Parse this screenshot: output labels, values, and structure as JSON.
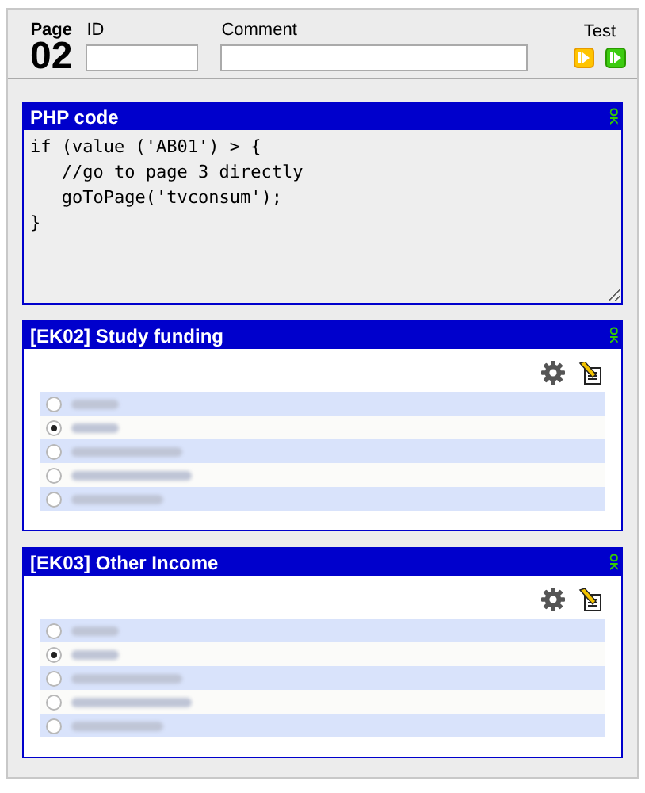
{
  "page": {
    "label": "Page",
    "number": "02"
  },
  "fields": [
    {
      "label": "ID"
    },
    {
      "label": "Comment"
    }
  ],
  "test": {
    "label": "Test"
  },
  "blocks": [
    {
      "kind": "code",
      "title": "PHP code",
      "status": "OK",
      "code": "if (value ('AB01') > {\n   //go to page 3 directly\n   goToPage('tvconsum');\n}"
    },
    {
      "kind": "choice",
      "title": "[EK02] Study funding",
      "status": "OK",
      "options": [
        {
          "selected": false
        },
        {
          "selected": true
        },
        {
          "selected": false
        },
        {
          "selected": false
        },
        {
          "selected": false
        }
      ]
    },
    {
      "kind": "choice",
      "title": "[EK03] Other Income",
      "status": "OK",
      "options": [
        {
          "selected": false
        },
        {
          "selected": true
        },
        {
          "selected": false
        },
        {
          "selected": false
        },
        {
          "selected": false
        }
      ]
    }
  ]
}
